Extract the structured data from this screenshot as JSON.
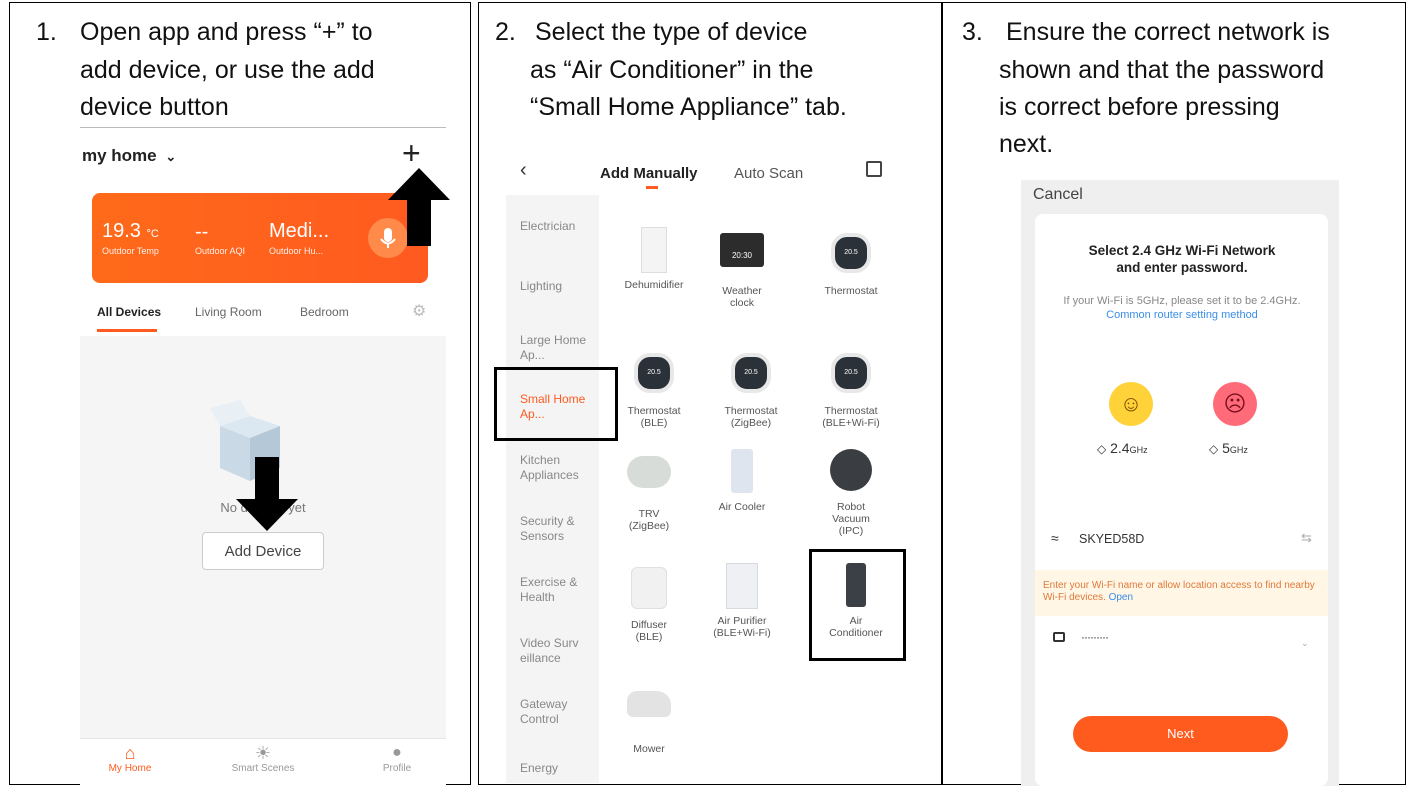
{
  "panel1": {
    "step_num": "1.",
    "caption_lines": [
      "Open app and press “+” to",
      "add device, or use the add",
      "device button"
    ],
    "home_title": "my home",
    "plus_glyph": "+",
    "weather": {
      "temp": "19.3",
      "temp_unit": "°C",
      "temp_label": "Outdoor Temp",
      "aqi": "--",
      "aqi_label": "Outdoor AQI",
      "humidity": "Medi...",
      "humidity_label": "Outdoor Hu..."
    },
    "room_tabs": [
      "All Devices",
      "Living Room",
      "Bedroom"
    ],
    "empty_text": "No devices yet",
    "add_device_label": "Add Device",
    "nav": [
      "My Home",
      "Smart Scenes",
      "Profile"
    ],
    "accent_color": "#ff5a1f"
  },
  "panel2": {
    "step_num": "2.",
    "caption_lines": [
      "Select the type of device",
      "as  “Air Conditioner” in the",
      "“Small Home Appliance” tab."
    ],
    "tabs": [
      "Add Manually",
      "Auto Scan"
    ],
    "categories": [
      "Electrician",
      "Lighting",
      "Large Home Ap...",
      "Small Home Ap...",
      "Kitchen Appliances",
      "Security & Sensors",
      "Exercise & Health",
      "Video Surv eillance",
      "Gateway Control",
      "Energy"
    ],
    "devices": [
      {
        "name": "Dehumidifier"
      },
      {
        "name": "Weather clock",
        "screen_text": "20:30"
      },
      {
        "name": "Thermostat",
        "screen_text": "20.5"
      },
      {
        "name": "Thermostat (BLE)",
        "screen_text": "20.5"
      },
      {
        "name": "Thermostat (ZigBee)",
        "screen_text": "20.5"
      },
      {
        "name": "Thermostat (BLE+Wi-Fi)",
        "screen_text": "20.5"
      },
      {
        "name": "TRV (ZigBee)"
      },
      {
        "name": "Air Cooler"
      },
      {
        "name": "Robot Vacuum (IPC)"
      },
      {
        "name": "Diffuser (BLE)"
      },
      {
        "name": "Air Purifier (BLE+Wi-Fi)"
      },
      {
        "name": "Air Conditioner"
      },
      {
        "name": "Mower"
      }
    ]
  },
  "panel3": {
    "step_num": "3.",
    "caption_lines": [
      "Ensure the correct network is",
      "shown and that the password",
      "is correct before pressing",
      "next."
    ],
    "cancel_label": "Cancel",
    "heading": "Select 2.4 GHz Wi-Fi Network and enter password.",
    "sub_text": "If your Wi-Fi is 5GHz, please set it to be 2.4GHz.",
    "router_link": "Common router setting method",
    "band_good": "2.4",
    "band_bad": "5",
    "band_unit": "GHz",
    "ssid": "SKYED58D",
    "warning_text": "Enter your Wi-Fi name or allow location access to find nearby Wi-Fi devices.",
    "warning_link": "Open",
    "password_mask": "·········",
    "next_label": "Next",
    "link_color": "#3a8ee6"
  }
}
